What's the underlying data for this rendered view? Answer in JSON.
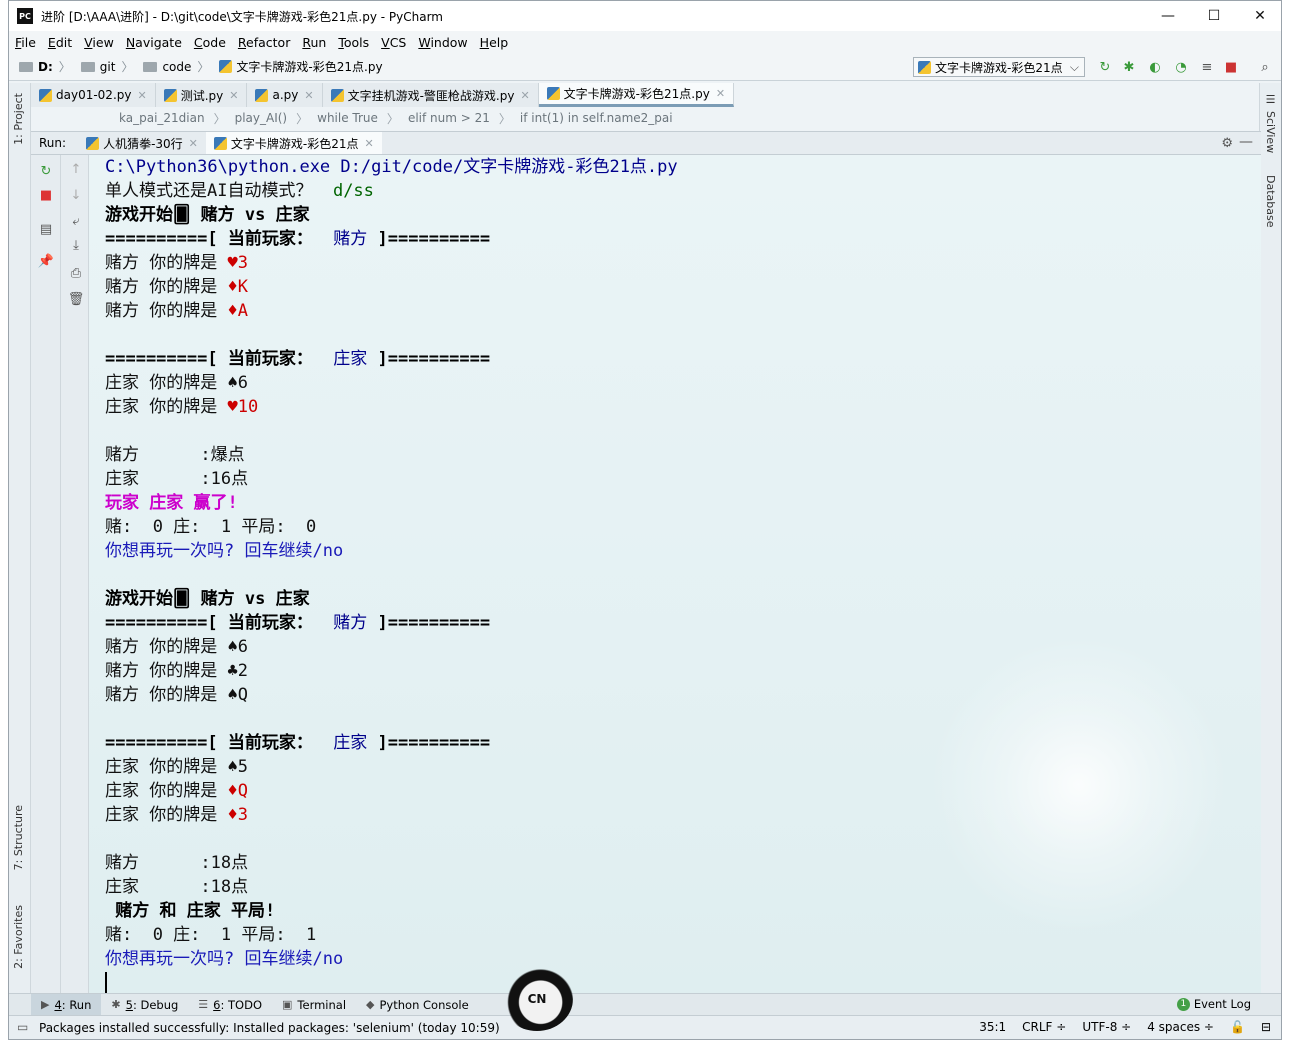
{
  "window": {
    "title": "进阶 [D:\\AAA\\进阶] - D:\\git\\code\\文字卡牌游戏-彩色21点.py - PyCharm",
    "app_logo": "PC",
    "minimize": "—",
    "maximize": "☐",
    "close": "✕"
  },
  "menu": [
    {
      "u": "F",
      "rest": "ile"
    },
    {
      "u": "E",
      "rest": "dit"
    },
    {
      "u": "V",
      "rest": "iew"
    },
    {
      "u": "N",
      "rest": "avigate"
    },
    {
      "u": "C",
      "rest": "ode"
    },
    {
      "u": "R",
      "rest": "efactor"
    },
    {
      "u": "R",
      "rest": "un"
    },
    {
      "u": "T",
      "rest": "ools"
    },
    {
      "u": "V",
      "rest": "CS"
    },
    {
      "u": "W",
      "rest": "indow"
    },
    {
      "u": "H",
      "rest": "elp"
    }
  ],
  "navbar": {
    "crumbs": [
      "D:",
      "git",
      "code",
      "文字卡牌游戏-彩色21点.py"
    ],
    "run_config": "文字卡牌游戏-彩色21点"
  },
  "tabs": [
    {
      "label": "day01-02.py",
      "active": false
    },
    {
      "label": "测试.py",
      "active": false
    },
    {
      "label": "a.py",
      "active": false
    },
    {
      "label": "文字挂机游戏-警匪枪战游戏.py",
      "active": false
    },
    {
      "label": "文字卡牌游戏-彩色21点.py",
      "active": true
    }
  ],
  "code_breadcrumbs": [
    "ka_pai_21dian",
    "play_AI()",
    "while True",
    "elif num > 21",
    "if int(1) in self.name2_pai"
  ],
  "left_stripe": {
    "project": "1: Project",
    "structure": "7: Structure",
    "favorites": "2: Favorites"
  },
  "right_stripe": {
    "sciview": "SciView",
    "database": "Database"
  },
  "run_panel": {
    "label": "Run:",
    "tabs": [
      {
        "label": "人机猜拳-30行",
        "active": false
      },
      {
        "label": "文字卡牌游戏-彩色21点",
        "active": true
      }
    ]
  },
  "console": [
    [
      {
        "t": "C:\\Python36\\python.exe D:/git/code/文字卡牌游戏-彩色21点.py",
        "c": "blue"
      }
    ],
    [
      {
        "t": "单人模式还是AI自动模式？  ",
        "c": "norm"
      },
      {
        "t": "d/ss",
        "c": "green"
      }
    ],
    [
      {
        "t": "游戏开始🂠 赌方 vs 庄家",
        "c": "bold"
      }
    ],
    [
      {
        "t": "==========[ 当前玩家：  ",
        "c": "bold"
      },
      {
        "t": "赌方",
        "c": "blue"
      },
      {
        "t": " ]==========",
        "c": "bold"
      }
    ],
    [
      {
        "t": "赌方 你的牌是 ",
        "c": "norm"
      },
      {
        "t": "♥3",
        "c": "red"
      }
    ],
    [
      {
        "t": "赌方 你的牌是 ",
        "c": "norm"
      },
      {
        "t": "♦K",
        "c": "red"
      }
    ],
    [
      {
        "t": "赌方 你的牌是 ",
        "c": "norm"
      },
      {
        "t": "♦A",
        "c": "red"
      }
    ],
    [
      {
        "t": "",
        "c": "norm"
      }
    ],
    [
      {
        "t": "==========[ 当前玩家：  ",
        "c": "bold"
      },
      {
        "t": "庄家",
        "c": "blue"
      },
      {
        "t": " ]==========",
        "c": "bold"
      }
    ],
    [
      {
        "t": "庄家 你的牌是 ♠6",
        "c": "norm"
      }
    ],
    [
      {
        "t": "庄家 你的牌是 ",
        "c": "norm"
      },
      {
        "t": "♥10",
        "c": "red"
      }
    ],
    [
      {
        "t": "",
        "c": "norm"
      }
    ],
    [
      {
        "t": "赌方      :爆点",
        "c": "norm"
      }
    ],
    [
      {
        "t": "庄家      :16点",
        "c": "norm"
      }
    ],
    [
      {
        "t": "玩家 庄家 赢了!",
        "c": "magenta"
      }
    ],
    [
      {
        "t": "赌:  0 庄:  1 平局:  0",
        "c": "norm"
      }
    ],
    [
      {
        "t": "你想再玩一次吗? 回车继续/no",
        "c": "link"
      }
    ],
    [
      {
        "t": "",
        "c": "norm"
      }
    ],
    [
      {
        "t": "游戏开始🂠 赌方 vs 庄家",
        "c": "bold"
      }
    ],
    [
      {
        "t": "==========[ 当前玩家：  ",
        "c": "bold"
      },
      {
        "t": "赌方",
        "c": "blue"
      },
      {
        "t": " ]==========",
        "c": "bold"
      }
    ],
    [
      {
        "t": "赌方 你的牌是 ♠6",
        "c": "norm"
      }
    ],
    [
      {
        "t": "赌方 你的牌是 ♣2",
        "c": "norm"
      }
    ],
    [
      {
        "t": "赌方 你的牌是 ♠Q",
        "c": "norm"
      }
    ],
    [
      {
        "t": "",
        "c": "norm"
      }
    ],
    [
      {
        "t": "==========[ 当前玩家：  ",
        "c": "bold"
      },
      {
        "t": "庄家",
        "c": "blue"
      },
      {
        "t": " ]==========",
        "c": "bold"
      }
    ],
    [
      {
        "t": "庄家 你的牌是 ♠5",
        "c": "norm"
      }
    ],
    [
      {
        "t": "庄家 你的牌是 ",
        "c": "norm"
      },
      {
        "t": "♦Q",
        "c": "red"
      }
    ],
    [
      {
        "t": "庄家 你的牌是 ",
        "c": "norm"
      },
      {
        "t": "♦3",
        "c": "red"
      }
    ],
    [
      {
        "t": "",
        "c": "norm"
      }
    ],
    [
      {
        "t": "赌方      :18点",
        "c": "norm"
      }
    ],
    [
      {
        "t": "庄家      :18点",
        "c": "norm"
      }
    ],
    [
      {
        "t": " 赌方 和 庄家 平局!",
        "c": "bold"
      }
    ],
    [
      {
        "t": "赌:  0 庄:  1 平局:  1",
        "c": "norm"
      }
    ],
    [
      {
        "t": "你想再玩一次吗? 回车继续/no",
        "c": "link"
      }
    ]
  ],
  "tool_windows": [
    {
      "num": "4",
      "label": ": Run",
      "icon": "▶",
      "active": true
    },
    {
      "num": "5",
      "label": ": Debug",
      "icon": "✱",
      "active": false
    },
    {
      "num": "6",
      "label": ": TODO",
      "icon": "☰",
      "active": false
    },
    {
      "num": "",
      "label": "Terminal",
      "icon": "▣",
      "active": false
    },
    {
      "num": "",
      "label": "Python Console",
      "icon": "◆",
      "active": false
    }
  ],
  "event_log": {
    "label": "Event Log",
    "count": "1"
  },
  "status": {
    "message": "Packages installed successfully: Installed packages: 'selenium' (today 10:59)",
    "position": "35:1",
    "line_sep": "CRLF ÷",
    "encoding": "UTF-8 ÷",
    "indent": "4 spaces ÷"
  },
  "watermark": "CN"
}
